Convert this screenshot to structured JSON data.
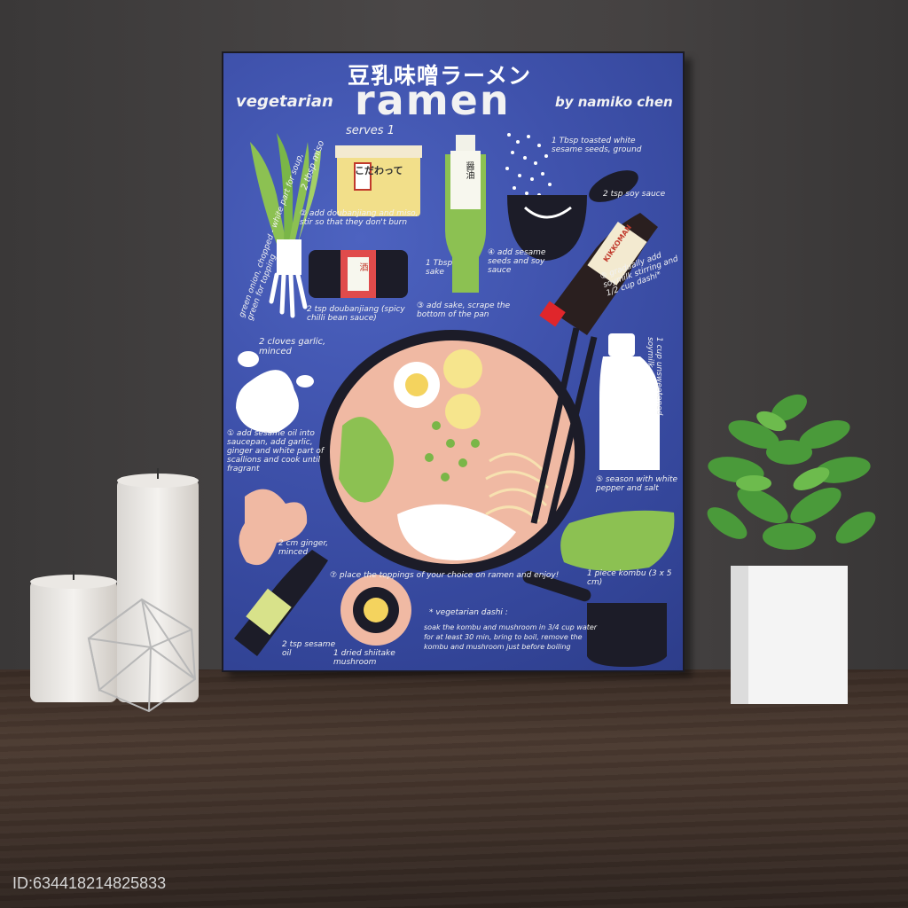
{
  "poster": {
    "title_jp": "豆乳味噌ラーメン",
    "title_prefix": "vegetarian",
    "title_main": "ramen",
    "author": "by namiko chen",
    "serves": "serves 1",
    "notes": {
      "miso": "2 tbsp miso",
      "step2": "② add doubanjiang and miso, stir so that they don't burn",
      "sake": "1 Tbsp sake",
      "doubanjiang": "2 tsp doubanjiang (spicy chilli bean sauce)",
      "step3": "③ add sake, scrape the bottom of the pan",
      "sesame_seeds": "1 Tbsp toasted white sesame seeds, ground",
      "soy_sauce": "2 tsp soy sauce",
      "step4": "④ add sesame seeds and soy sauce",
      "step5": "⑤ gradually add soymilk stirring and 1/2 cup dashi*",
      "green_onion": "green onion, chopped - white part for soup, green for topping",
      "garlic": "2 cloves garlic, minced",
      "soymilk": "1 cup unsweetened soymilk",
      "step1": "① add sesame oil into saucepan, add garlic, ginger and white part of scallions and cook until fragrant",
      "season": "⑤ season with white pepper and salt",
      "ginger": "2 cm ginger, minced",
      "step7": "⑦ place the toppings of your choice on ramen and enjoy!",
      "kombu": "1 piece kombu (3 x 5 cm)",
      "sesame_oil": "2 tsp sesame oil",
      "shiitake": "1 dried shiitake mushroom",
      "dashi_title": "* vegetarian dashi :",
      "dashi_body": "soak the kombu and mushroom in 3/4 cup water for at least 30 min, bring to boil, remove the kombu and mushroom just before boiling"
    },
    "labels": {
      "sauce_bottle": "醤油",
      "miso_tub": "こだわって",
      "soy_bottle": "KIKKOMAN",
      "sake_bottle": "酒"
    }
  },
  "watermark": "ID:6344182148258​33",
  "colors": {
    "poster_blue": "#3f52ac",
    "wall": "#444141",
    "floor": "#3d2f28",
    "broth": "#f0b9a3",
    "green": "#8cc152"
  }
}
